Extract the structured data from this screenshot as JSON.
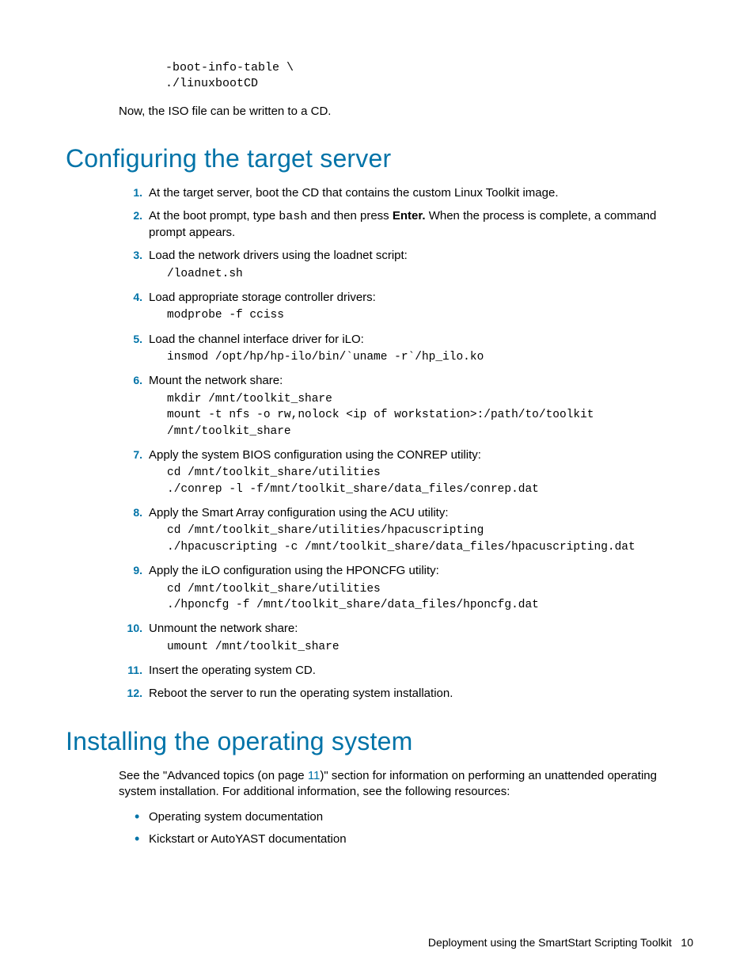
{
  "top_code": "-boot-info-table \\\n./linuxbootCD",
  "aside_text": "Now, the ISO file can be written to a CD.",
  "h2_config": "Configuring the target server",
  "steps": [
    {
      "text": "At the target server, boot the CD that contains the custom Linux Toolkit image."
    },
    {
      "prefix": "At the boot prompt, type ",
      "code_inline": "bash",
      "mid": " and then press ",
      "bold": "Enter.",
      "suffix": " When the process is complete, a command prompt appears."
    },
    {
      "text": "Load the network drivers using the loadnet script:",
      "code": "/loadnet.sh"
    },
    {
      "text": "Load appropriate storage controller drivers:",
      "code": "modprobe -f cciss"
    },
    {
      "text": "Load the channel interface driver for iLO:",
      "code": "insmod /opt/hp/hp-ilo/bin/`uname -r`/hp_ilo.ko"
    },
    {
      "text": "Mount the network share:",
      "code": "mkdir /mnt/toolkit_share\nmount -t nfs -o rw,nolock <ip of workstation>:/path/to/toolkit\n/mnt/toolkit_share"
    },
    {
      "text": "Apply the system BIOS configuration using the CONREP utility:",
      "code": "cd /mnt/toolkit_share/utilities\n./conrep -l -f/mnt/toolkit_share/data_files/conrep.dat"
    },
    {
      "text": "Apply the Smart Array configuration using the ACU utility:",
      "code": "cd /mnt/toolkit_share/utilities/hpacuscripting\n./hpacuscripting -c /mnt/toolkit_share/data_files/hpacuscripting.dat"
    },
    {
      "text": "Apply the iLO configuration using the HPONCFG utility:",
      "code": "cd /mnt/toolkit_share/utilities\n./hponcfg -f /mnt/toolkit_share/data_files/hponcfg.dat"
    },
    {
      "text": "Unmount the network share:",
      "code": "umount /mnt/toolkit_share"
    },
    {
      "text": "Insert the operating system CD."
    },
    {
      "text": "Reboot the server to run the operating system installation."
    }
  ],
  "h2_install": "Installing the operating system",
  "install_para_pre": "See the \"Advanced topics (on page ",
  "install_link": "11",
  "install_para_post": ")\" section for information on performing an unattended operating system installation. For additional information, see the following resources:",
  "bullets": [
    "Operating system documentation",
    "Kickstart or AutoYAST documentation"
  ],
  "footer_text": "Deployment using the SmartStart Scripting Toolkit",
  "footer_page": "10"
}
